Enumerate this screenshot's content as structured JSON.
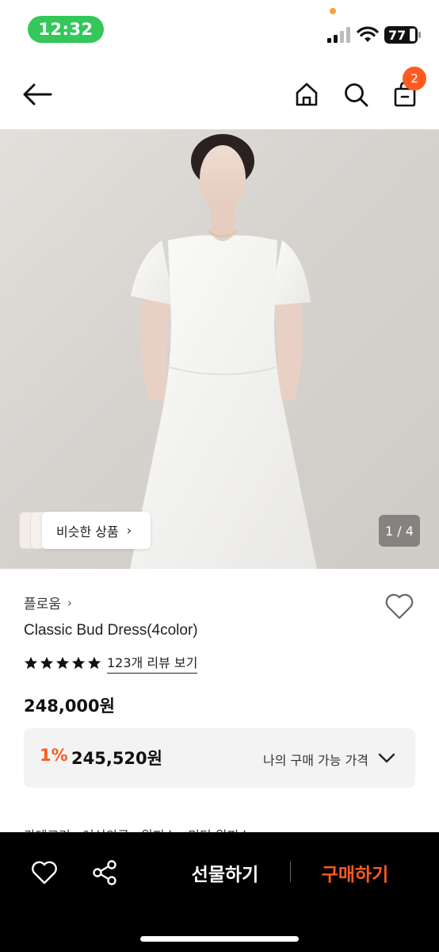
{
  "status_bar": {
    "time": "12:32",
    "battery": "77"
  },
  "nav": {
    "cart_count": "2"
  },
  "hero": {
    "similar_label": "비슷한 상품",
    "similar_chevron": "›",
    "page_indicator": "1 / 4"
  },
  "product": {
    "brand": "플로움",
    "brand_chevron": "›",
    "title": "Classic Bud Dress(4color)",
    "rating_stars": 5,
    "review_link": "123개 리뷰 보기",
    "price": "248,000원",
    "my_price": {
      "discount_rate": "1%",
      "price": "245,520원",
      "label": "나의 구매 가능 가격"
    },
    "category": [
      "카테고리",
      "여성의류",
      "원피스",
      "미디 원피스"
    ]
  },
  "bottom_bar": {
    "gift_label": "선물하기",
    "buy_label": "구매하기"
  },
  "colors": {
    "accent": "#ff5a1f",
    "status_green": "#34c759",
    "bottom_bar": "#000000"
  },
  "icons": [
    "back-arrow-icon",
    "home-icon",
    "search-icon",
    "shopping-bag-icon",
    "heart-icon",
    "share-icon",
    "star-icon",
    "chevron-down-icon"
  ]
}
